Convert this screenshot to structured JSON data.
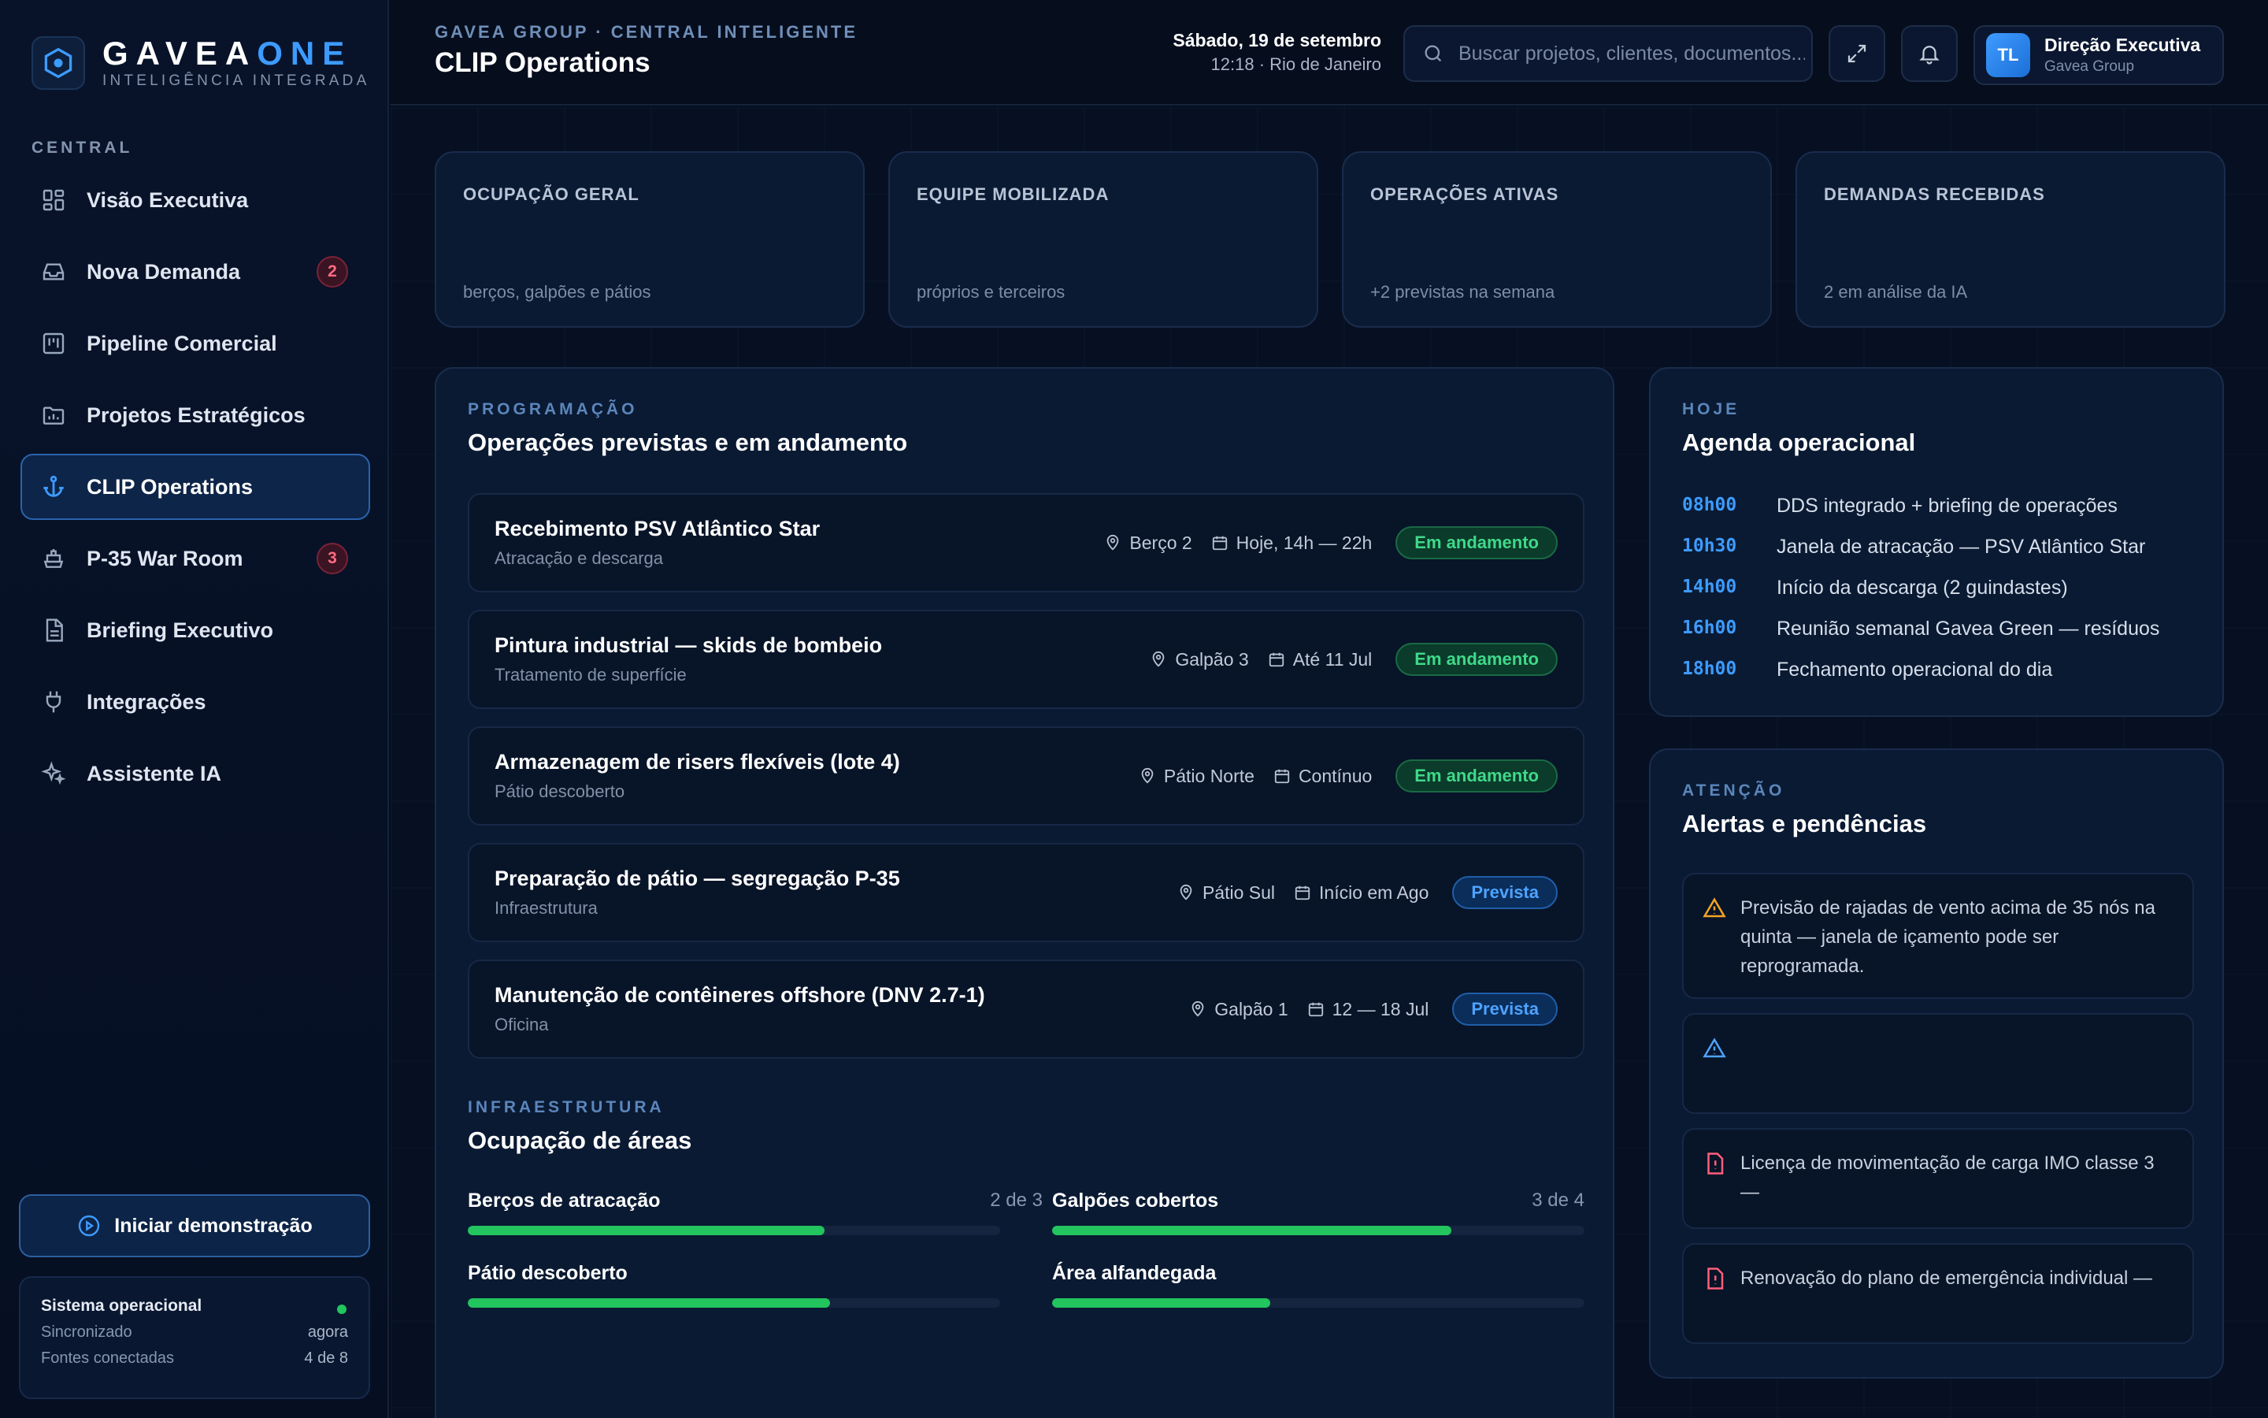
{
  "brand": {
    "name_part1": "GAVEA",
    "name_part2": "ONE",
    "tagline": "INTELIGÊNCIA INTEGRADA"
  },
  "sidebar": {
    "section_label": "CENTRAL",
    "items": [
      {
        "label": "Visão Executiva",
        "icon": "grid-icon",
        "badge": ""
      },
      {
        "label": "Nova Demanda",
        "icon": "inbox-icon",
        "badge": "2"
      },
      {
        "label": "Pipeline Comercial",
        "icon": "kanban-icon",
        "badge": ""
      },
      {
        "label": "Projetos Estratégicos",
        "icon": "folder-chart-icon",
        "badge": ""
      },
      {
        "label": "CLIP Operations",
        "icon": "anchor-icon",
        "badge": "",
        "active": true
      },
      {
        "label": "P-35 War Room",
        "icon": "ship-icon",
        "badge": "3"
      },
      {
        "label": "Briefing Executivo",
        "icon": "document-icon",
        "badge": ""
      },
      {
        "label": "Integrações",
        "icon": "plug-icon",
        "badge": ""
      },
      {
        "label": "Assistente IA",
        "icon": "sparkles-icon",
        "badge": ""
      }
    ],
    "demo_button": "Iniciar demonstração",
    "system": {
      "title": "Sistema operacional",
      "synced_label": "Sincronizado",
      "synced_value": "agora",
      "sources_label": "Fontes conectadas",
      "sources_value": "4 de 8"
    }
  },
  "header": {
    "breadcrumb": "GAVEA GROUP · CENTRAL INTELIGENTE",
    "title": "CLIP Operations",
    "date": "Sábado, 19 de setembro",
    "time_location": "12:18 · Rio de Janeiro",
    "search_placeholder": "Buscar projetos, clientes, documentos...",
    "user": {
      "initials": "TL",
      "name": "Direção Executiva",
      "org": "Gavea Group"
    }
  },
  "kpis": [
    {
      "label": "OCUPAÇÃO GERAL",
      "sub": "berços, galpões e pátios"
    },
    {
      "label": "EQUIPE MOBILIZADA",
      "sub": "próprios e terceiros"
    },
    {
      "label": "OPERAÇÕES ATIVAS",
      "sub": "+2 previstas na semana"
    },
    {
      "label": "DEMANDAS RECEBIDAS",
      "sub": "2 em análise da IA"
    }
  ],
  "operations": {
    "eyebrow": "PROGRAMAÇÃO",
    "title": "Operações previstas e em andamento",
    "rows": [
      {
        "title": "Recebimento PSV Atlântico Star",
        "sub": "Atracação e descarga",
        "location": "Berço 2",
        "when": "Hoje, 14h — 22h",
        "status": "Em andamento",
        "status_type": "run"
      },
      {
        "title": "Pintura industrial — skids de bombeio",
        "sub": "Tratamento de superfície",
        "location": "Galpão 3",
        "when": "Até 11 Jul",
        "status": "Em andamento",
        "status_type": "run"
      },
      {
        "title": "Armazenagem de risers flexíveis (lote 4)",
        "sub": "Pátio descoberto",
        "location": "Pátio Norte",
        "when": "Contínuo",
        "status": "Em andamento",
        "status_type": "run"
      },
      {
        "title": "Preparação de pátio — segregação P-35",
        "sub": "Infraestrutura",
        "location": "Pátio Sul",
        "when": "Início em Ago",
        "status": "Prevista",
        "status_type": "plan"
      },
      {
        "title": "Manutenção de contêineres offshore (DNV 2.7-1)",
        "sub": "Oficina",
        "location": "Galpão 1",
        "when": "12 — 18 Jul",
        "status": "Prevista",
        "status_type": "plan"
      }
    ]
  },
  "occupancy": {
    "eyebrow": "INFRAESTRUTURA",
    "title": "Ocupação de áreas",
    "items": [
      {
        "label": "Berços de atracação",
        "count": "2 de 3",
        "fill": 0.67
      },
      {
        "label": "Galpões cobertos",
        "count": "3 de 4",
        "fill": 0.75
      },
      {
        "label": "Pátio descoberto",
        "count": "",
        "fill": 0.68
      },
      {
        "label": "Área alfandegada",
        "count": "",
        "fill": 0.41
      }
    ]
  },
  "agenda": {
    "eyebrow": "HOJE",
    "title": "Agenda operacional",
    "items": [
      {
        "time": "08h00",
        "text": "DDS integrado + briefing de operações"
      },
      {
        "time": "10h30",
        "text": "Janela de atracação — PSV Atlântico Star"
      },
      {
        "time": "14h00",
        "text": "Início da descarga (2 guindastes)"
      },
      {
        "time": "16h00",
        "text": "Reunião semanal Gavea Green — resíduos"
      },
      {
        "time": "18h00",
        "text": "Fechamento operacional do dia"
      }
    ]
  },
  "alerts": {
    "eyebrow": "ATENÇÃO",
    "title": "Alertas e pendências",
    "items": [
      {
        "icon": "warning-icon",
        "color": "#f5a524",
        "text": "Previsão de rajadas de vento acima de 35 nós na quinta — janela de içamento pode ser reprogramada."
      },
      {
        "icon": "warning-icon",
        "color": "#4da3ff",
        "text": ""
      },
      {
        "icon": "alert-file-icon",
        "color": "#ff5f7a",
        "text": "Licença de movimentação de carga IMO classe 3 —"
      },
      {
        "icon": "alert-file-icon",
        "color": "#ff5f7a",
        "text": "Renovação do plano de emergência individual —"
      }
    ]
  },
  "colors": {
    "accent": "#3d9bff",
    "success": "#22c55e",
    "danger": "#ff5f7a",
    "warning": "#f5a524"
  }
}
